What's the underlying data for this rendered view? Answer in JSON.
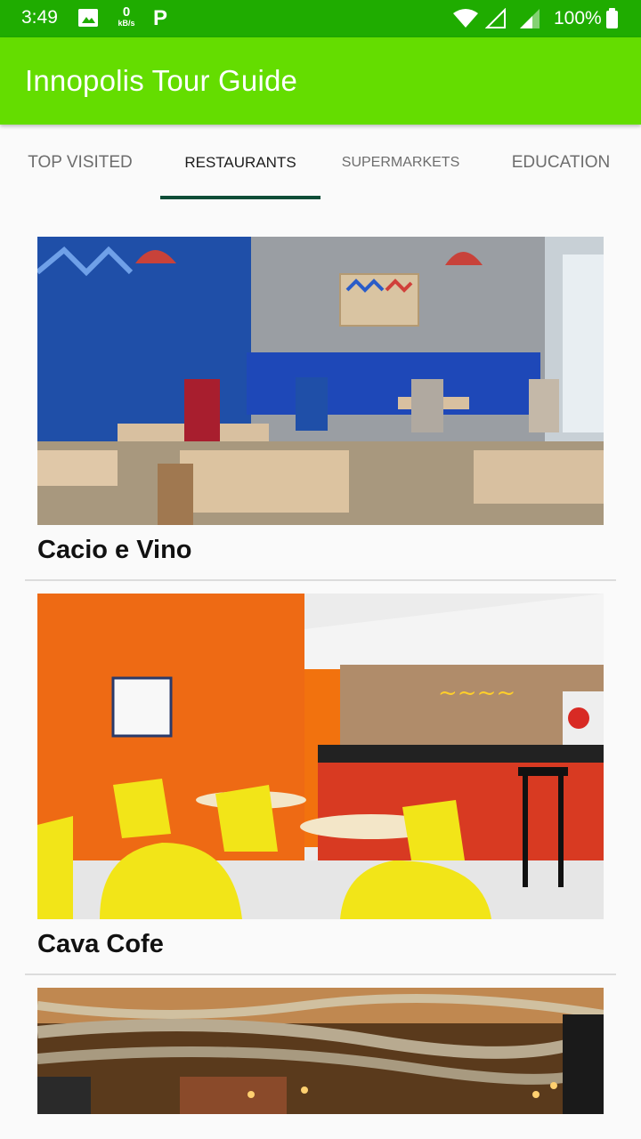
{
  "status_bar": {
    "time": "3:49",
    "net_speed_value": "0",
    "net_speed_unit": "kB/s",
    "app_icon_letter": "P",
    "battery_percent": "100%",
    "icons": [
      "gallery-icon",
      "wifi-icon",
      "signal-icon",
      "battery-icon"
    ]
  },
  "app_bar": {
    "title": "Innopolis Tour Guide",
    "color": "#64dd00"
  },
  "tabs": [
    {
      "label": "Top Visited",
      "selected": false
    },
    {
      "label": "Restaurants",
      "selected": true
    },
    {
      "label": "Supermarkets",
      "selected": false
    },
    {
      "label": "Education",
      "selected": false
    }
  ],
  "colors": {
    "status_bar": "#1fac00",
    "tab_indicator": "#0f4d37"
  },
  "places": [
    {
      "name": "Cacio e Vino"
    },
    {
      "name": "Cava Cofe"
    },
    {
      "name": ""
    }
  ]
}
